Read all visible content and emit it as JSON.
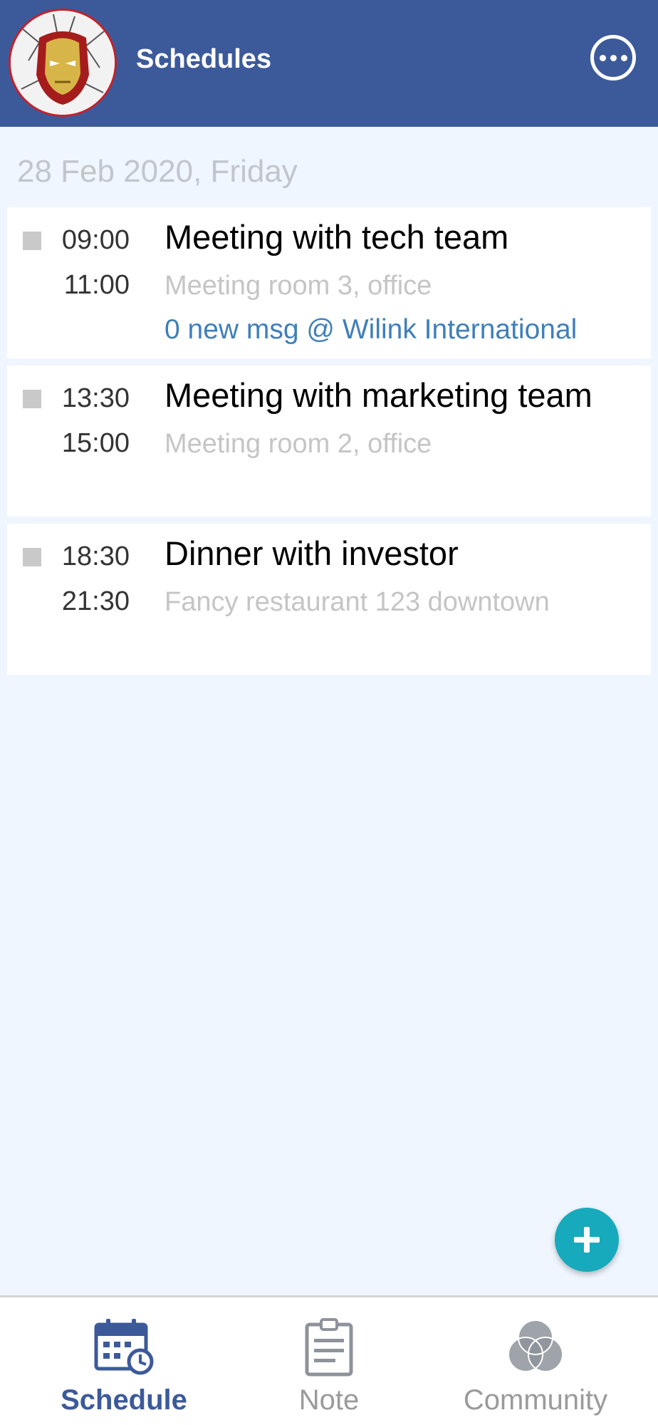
{
  "header": {
    "title": "Schedules",
    "avatar_icon": "iron-man-mask-avatar",
    "more_icon": "more-options-icon",
    "color": "#3c5a9a"
  },
  "date_heading": "28 Feb 2020, Friday",
  "events": [
    {
      "start": "09:00",
      "end": "11:00",
      "title": "Meeting with tech team",
      "location": "Meeting room 3, office",
      "message": "0 new msg @ Wilink International"
    },
    {
      "start": "13:30",
      "end": "15:00",
      "title": "Meeting with marketing team",
      "location": "Meeting room 2, office"
    },
    {
      "start": "18:30",
      "end": "21:30",
      "title": "Dinner with investor",
      "location": "Fancy restaurant 123 downtown"
    }
  ],
  "fab": {
    "icon": "plus-icon",
    "color": "#17aabc"
  },
  "tabs": [
    {
      "label": "Schedule",
      "icon": "calendar-icon",
      "active": true
    },
    {
      "label": "Note",
      "icon": "note-icon",
      "active": false
    },
    {
      "label": "Community",
      "icon": "community-icon",
      "active": false
    }
  ],
  "colors": {
    "background": "#f0f6ff",
    "link": "#3f7fba",
    "muted_text": "#c5c5c5"
  }
}
